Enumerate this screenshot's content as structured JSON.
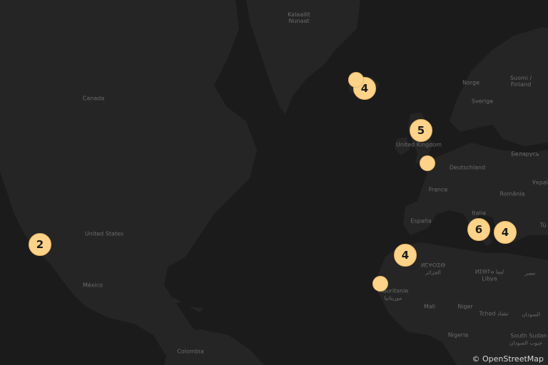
{
  "map": {
    "theme": "dark",
    "colors": {
      "land": "#252525",
      "water": "#1b1b1b",
      "marker_fill": "#fdd38a",
      "marker_stroke": "#e9b765",
      "label": "#6b6b6b"
    },
    "labels": {
      "greenland": "Kalaallit\nNunaat",
      "canada": "Canada",
      "united_states": "United States",
      "mexico": "México",
      "colombia": "Colombia",
      "norge": "Norge",
      "sverige": "Sverige",
      "suomi": "Suomi /\nFinland",
      "united_kingdom": "United Kingdom",
      "deutschland": "Deutschland",
      "belarus": "Беларусь",
      "france": "France",
      "romania": "România",
      "ukraine": "Украї",
      "espana": "España",
      "italia": "Italia",
      "turkey": "Tü",
      "morocco": "ⵍⵎⵖⵔⵉⴱ",
      "algeria_ar": "الجزائر",
      "libya_latin": "ⵍⵉⴱⵢⴰ ليبيا",
      "libya": "Libya",
      "egypt": "مصر",
      "mauritanie": "Mauritanie",
      "mauritania_ar": "موريتانيا",
      "mali": "Mali",
      "niger": "Niger",
      "tchad": "Tchad تشاد",
      "sudan": "السودان",
      "nigeria": "Nigeria",
      "south_sudan": "South Sudan",
      "south_sudan_ar": "جنوب السودان"
    },
    "clusters": [
      {
        "id": "us-west",
        "count": "2"
      },
      {
        "id": "iceland-small",
        "count": ""
      },
      {
        "id": "iceland",
        "count": "4"
      },
      {
        "id": "uk",
        "count": "5"
      },
      {
        "id": "benelux",
        "count": ""
      },
      {
        "id": "italy",
        "count": "6"
      },
      {
        "id": "greece",
        "count": "4"
      },
      {
        "id": "morocco",
        "count": "4"
      },
      {
        "id": "canary",
        "count": ""
      }
    ],
    "attribution": "© OpenStreetMap"
  }
}
